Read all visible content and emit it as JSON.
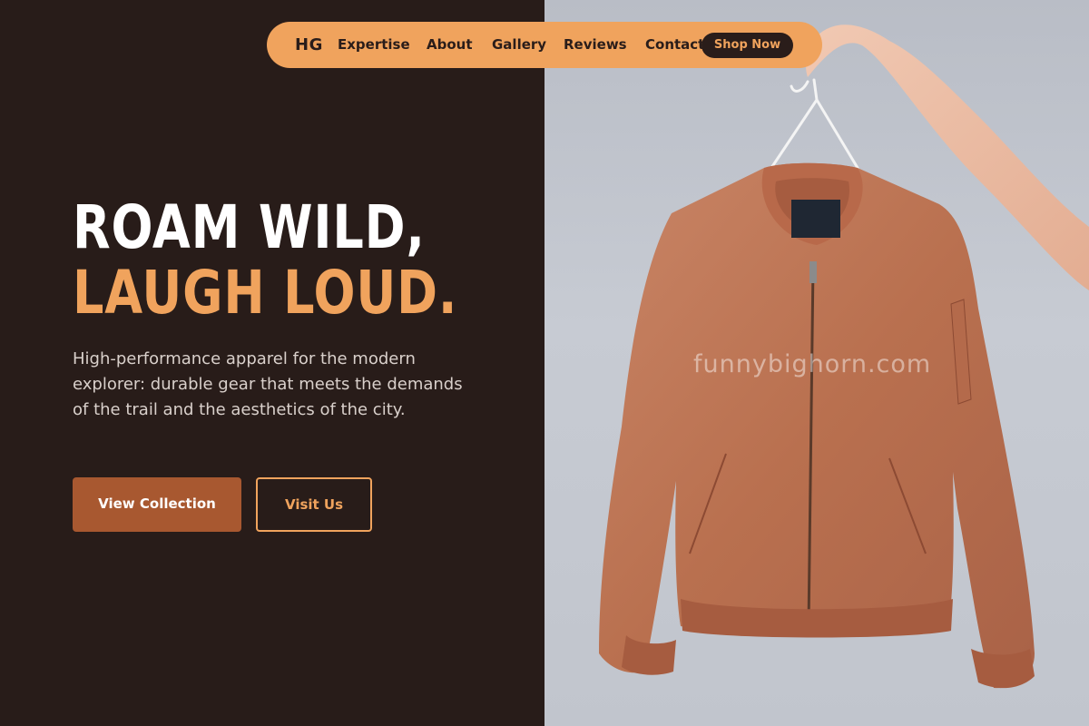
{
  "nav": {
    "logo": "HG",
    "links": [
      "Expertise",
      "About",
      "Gallery",
      "Reviews",
      "Contact"
    ],
    "cta": "Shop Now"
  },
  "hero": {
    "headline_line1": "ROAM WILD,",
    "headline_line2": "LAUGH LOUD.",
    "description": "High-performance apparel for the modern explorer: durable gear that meets the demands of the trail and the aesthetics of the city.",
    "primary_button": "View Collection",
    "secondary_button": "Visit Us"
  },
  "image": {
    "subject": "jacket-on-hanger",
    "watermark": "funnybighorn.com"
  },
  "colors": {
    "background": "#281c19",
    "accent": "#f0a35d",
    "button": "#a85830",
    "jacket": "#c47a5b"
  }
}
